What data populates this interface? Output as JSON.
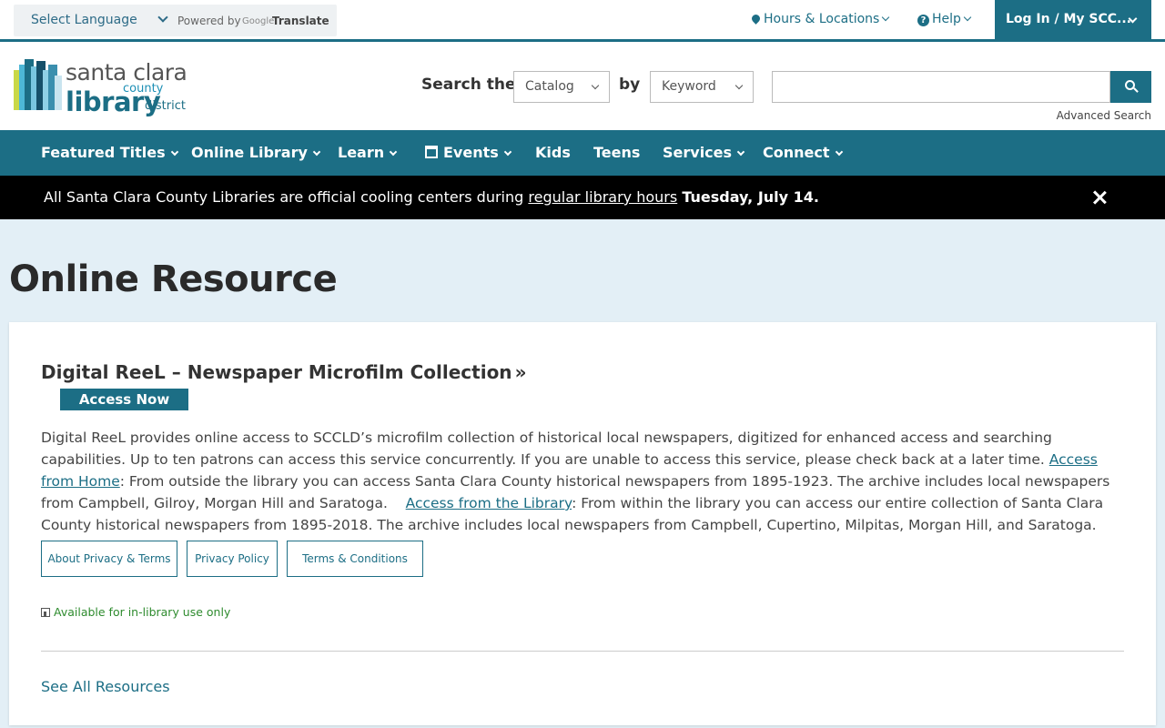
{
  "lang": {
    "select_label": "Select Language",
    "powered_by": "Powered by",
    "google": "Google",
    "translate": "Translate"
  },
  "util": {
    "hours": "Hours & Locations",
    "help": "Help",
    "login": "Log In / My SCC..."
  },
  "logo": {
    "line1": "santa clara",
    "line2": "county",
    "line3": "library",
    "line4": "district"
  },
  "search": {
    "label": "Search the",
    "scope": "Catalog",
    "by": "by",
    "type": "Keyword",
    "value": "",
    "advanced": "Advanced Search"
  },
  "nav": {
    "items": [
      {
        "label": "Featured Titles"
      },
      {
        "label": "Online Library"
      },
      {
        "label": "Learn"
      },
      {
        "label": "Events"
      },
      {
        "label": "Kids"
      },
      {
        "label": "Teens"
      },
      {
        "label": "Services"
      },
      {
        "label": "Connect"
      }
    ]
  },
  "alert": {
    "text": "All Santa Clara County Libraries are official cooling centers during ",
    "link": "regular library hours",
    "bold": "Tuesday, July 14."
  },
  "page": {
    "title": "Online Resource"
  },
  "resource": {
    "title": "Digital ReeL – Newspaper Microfilm Collection",
    "access": "Access Now",
    "desc_1": "Digital ReeL provides online access to SCCLD’s microfilm collection of historical local newspapers, digitized for enhanced access and searching capabilities. Up to ten patrons can access this service concurrently. If you are unable to access this service, please check back at a later time. ",
    "link_home": "Access from Home",
    "desc_2": ": From outside the library you can access Santa Clara County historical newspapers from 1895-1923. The archive includes local newspapers from Campbell, Gilroy, Morgan Hill and Saratoga.    ",
    "link_library": "Access from the Library",
    "desc_3": ": From within the library you can access our entire collection of Santa Clara County historical newspapers from 1895-2018.  The archive includes local newspapers from Campbell, Cupertino, Milpitas, Morgan Hill, and Saratoga.",
    "buttons": [
      "About Privacy & Terms",
      "Privacy Policy",
      "Terms & Conditions"
    ],
    "availability": "Available for in-library use only",
    "see_all": "See All Resources"
  }
}
